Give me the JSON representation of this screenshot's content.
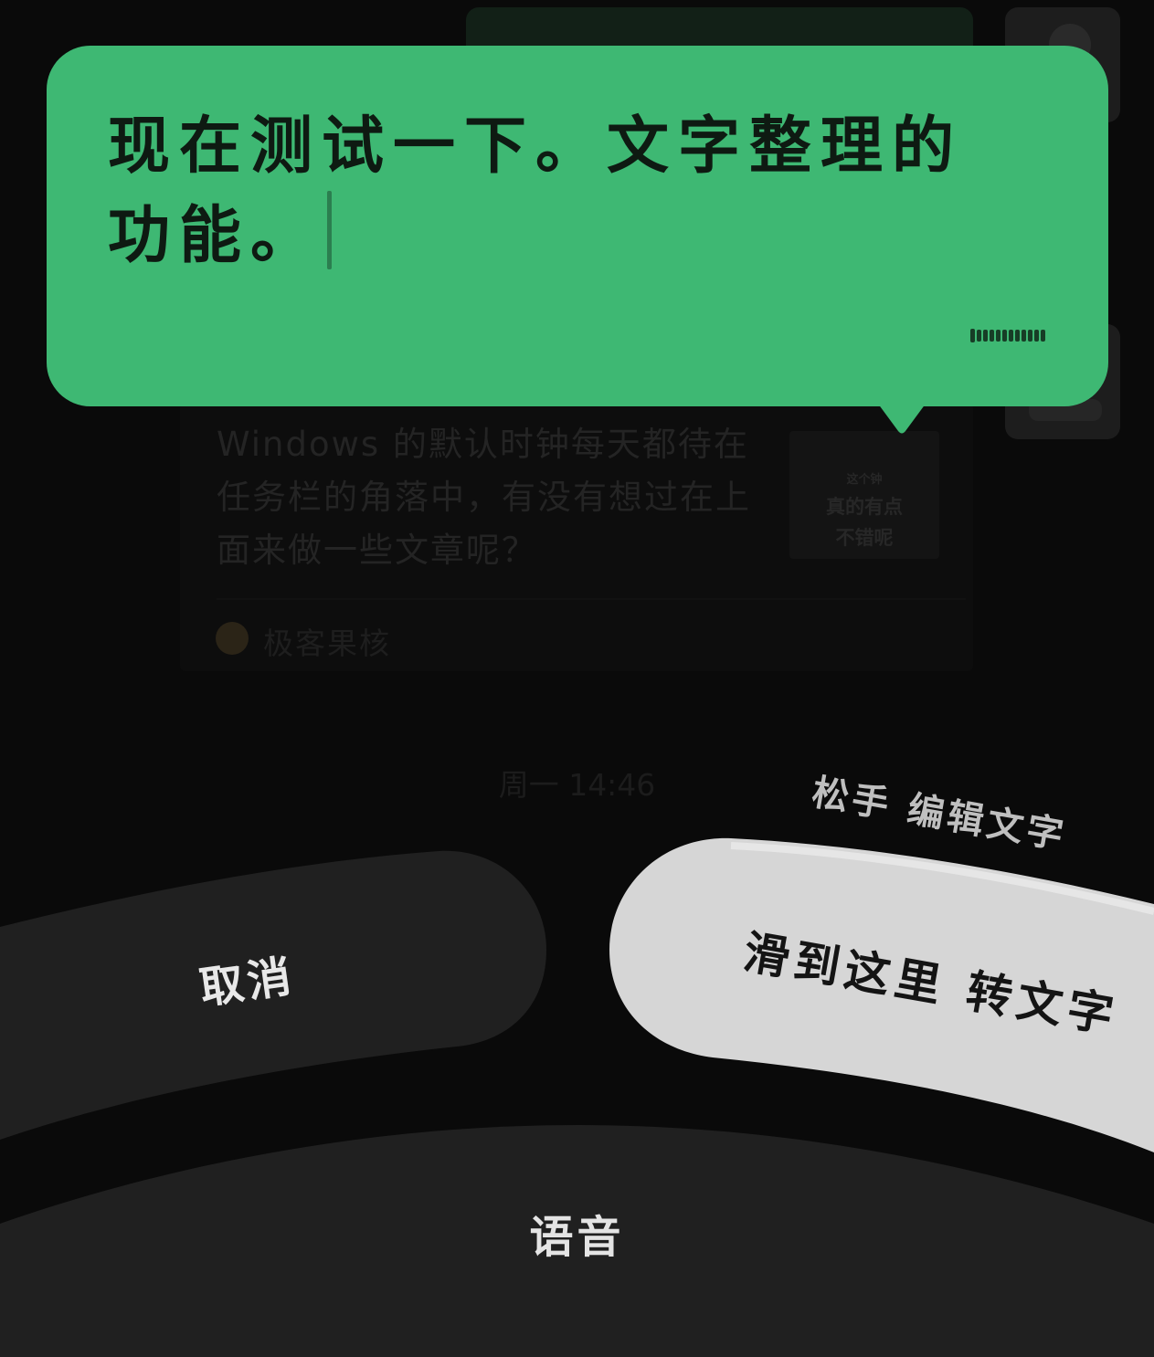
{
  "background_chat": {
    "card_text": "Windows 的默认时钟每天都待在任务栏的角落中，有没有想过在上面来做一些文章呢？",
    "thumbnail": {
      "line1": "这个钟",
      "line2": "真的有点",
      "line3": "不错呢"
    },
    "source": "极客果核",
    "timestamp": "周一 14:46"
  },
  "bubble": {
    "text": "现在测试一下。文字整理的功能。",
    "color": "#3eb873"
  },
  "controls": {
    "hint": "松手 编辑文字",
    "cancel_label": "取消",
    "to_text_label": "滑到这里 转文字",
    "voice_label": "语音"
  }
}
